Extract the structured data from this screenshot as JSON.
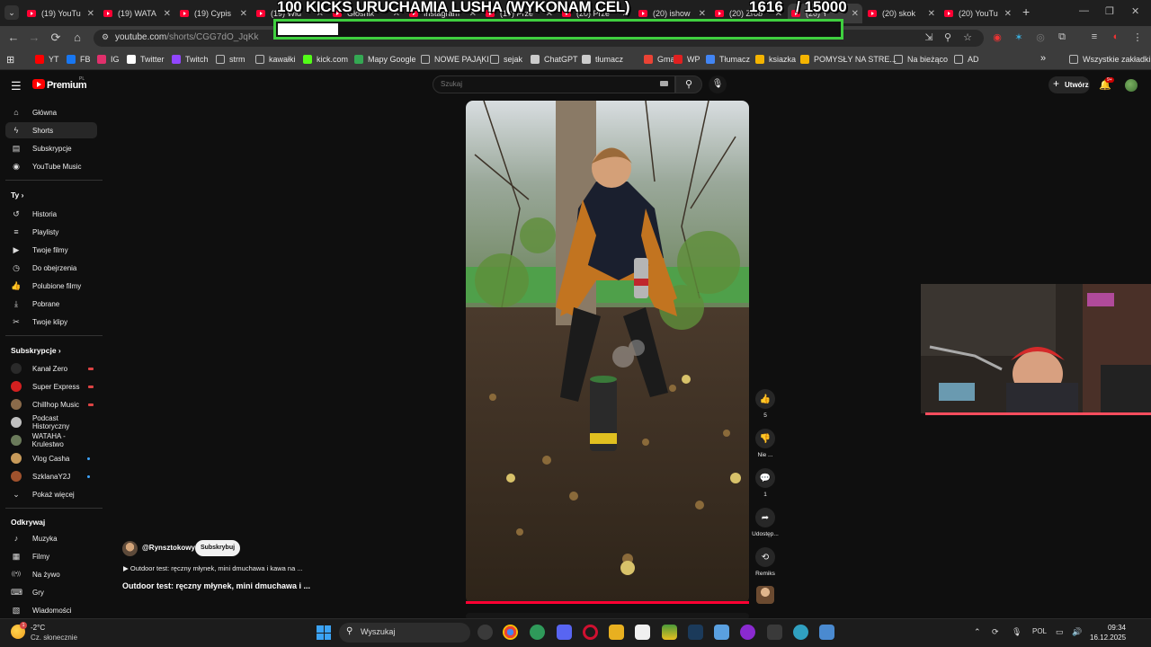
{
  "browser": {
    "tabs": [
      {
        "label": "(19) YouTu",
        "active": false
      },
      {
        "label": "(19) WATA",
        "active": false
      },
      {
        "label": "(19) Cypis",
        "active": false
      },
      {
        "label": "(19) Wid",
        "active": false
      },
      {
        "label": "Głośnik",
        "active": false
      },
      {
        "label": "Instagram",
        "active": false
      },
      {
        "label": "(19) Prze",
        "active": false
      },
      {
        "label": "(20) Prze",
        "active": false
      },
      {
        "label": "(20) ishow",
        "active": false
      },
      {
        "label": "(20) Zrób",
        "active": false
      },
      {
        "label": "(20) Y",
        "active": true
      },
      {
        "label": "(20) skok",
        "active": false
      },
      {
        "label": "(20) YouTu",
        "active": false
      }
    ],
    "url_host": "youtube.com",
    "url_path": "/shorts/CGG7dO_JqKk",
    "bookmarks": [
      {
        "label": "YT",
        "icon": "youtube-icon",
        "color": "#ff0000"
      },
      {
        "label": "FB",
        "icon": "facebook-icon",
        "color": "#1877f2"
      },
      {
        "label": "IG",
        "icon": "instagram-icon",
        "color": "#e1306c"
      },
      {
        "label": "Twitter",
        "icon": "x-icon",
        "color": "#ffffff"
      },
      {
        "label": "Twitch",
        "icon": "twitch-icon",
        "color": "#9146ff"
      },
      {
        "label": "strm",
        "icon": "folder-icon",
        "color": ""
      },
      {
        "label": "kawałki",
        "icon": "folder-icon",
        "color": ""
      },
      {
        "label": "kick.com",
        "icon": "kick-icon",
        "color": "#53fc18"
      },
      {
        "label": "Mapy Google",
        "icon": "maps-icon",
        "color": "#34a853"
      },
      {
        "label": "NOWE PAJĄKI",
        "icon": "folder-icon",
        "color": ""
      },
      {
        "label": "sejak",
        "icon": "folder-icon",
        "color": ""
      },
      {
        "label": "ChatGPT",
        "icon": "chatgpt-icon",
        "color": "#cccccc"
      },
      {
        "label": "tłumacz",
        "icon": "translate-icon",
        "color": "#cccccc"
      },
      {
        "label": "Gmail",
        "icon": "gmail-icon",
        "color": "#ea4335"
      },
      {
        "label": "WP",
        "icon": "wp-icon",
        "color": "#e02020"
      },
      {
        "label": "Tłumacz",
        "icon": "translate-icon",
        "color": "#4285f4"
      },
      {
        "label": "ksiazka",
        "icon": "book-icon",
        "color": "#f4b400"
      },
      {
        "label": "POMYSŁY NA STRE...",
        "icon": "grid-icon",
        "color": "#f4b400"
      },
      {
        "label": "Na bieżąco",
        "icon": "folder-icon",
        "color": ""
      },
      {
        "label": "AD",
        "icon": "folder-icon",
        "color": ""
      }
    ],
    "all_bookmarks": "Wszystkie zakładki"
  },
  "overlay": {
    "title": "100 KICKS URUCHAMIA LUSHA (WYKONAM CEL)",
    "current": "1616",
    "goal": "/ 15000",
    "progress": 0.108
  },
  "youtube": {
    "premium": "Premium",
    "region": "PL",
    "search_placeholder": "Szukaj",
    "create_label": "Utwórz",
    "notifications": "9+",
    "nav_main": [
      {
        "label": "Główna",
        "icon": "home-icon"
      },
      {
        "label": "Shorts",
        "icon": "shorts-icon"
      },
      {
        "label": "Subskrypcje",
        "icon": "subscriptions-icon"
      },
      {
        "label": "YouTube Music",
        "icon": "music-icon"
      }
    ],
    "you_heading": "Ty",
    "nav_you": [
      {
        "label": "Historia",
        "icon": "history-icon"
      },
      {
        "label": "Playlisty",
        "icon": "playlist-icon"
      },
      {
        "label": "Twoje filmy",
        "icon": "video-icon"
      },
      {
        "label": "Do obejrzenia",
        "icon": "clock-icon"
      },
      {
        "label": "Polubione filmy",
        "icon": "like-icon"
      },
      {
        "label": "Pobrane",
        "icon": "download-icon"
      },
      {
        "label": "Twoje klipy",
        "icon": "scissors-icon"
      }
    ],
    "subs_heading": "Subskrypcje",
    "subscriptions": [
      {
        "label": "Kanał Zero",
        "avatar": "#2a2a2a",
        "status": "live"
      },
      {
        "label": "Super Express",
        "avatar": "#d32020",
        "status": "live"
      },
      {
        "label": "Chillhop Music",
        "avatar": "#8a6a4a",
        "status": "live"
      },
      {
        "label": "Podcast Historyczny",
        "avatar": "#bfbfbf",
        "status": ""
      },
      {
        "label": "WATAHA - Krulestwo",
        "avatar": "#6a7a5a",
        "status": ""
      },
      {
        "label": "Vlog Casha",
        "avatar": "#c79a5a",
        "status": "new"
      },
      {
        "label": "SzklanaY2J",
        "avatar": "#a0522d",
        "status": "new"
      }
    ],
    "show_more": "Pokaż więcej",
    "explore_heading": "Odkrywaj",
    "nav_explore": [
      {
        "label": "Muzyka",
        "icon": "music-note-icon"
      },
      {
        "label": "Filmy",
        "icon": "film-icon"
      },
      {
        "label": "Na żywo",
        "icon": "live-icon"
      },
      {
        "label": "Gry",
        "icon": "gamepad-icon"
      },
      {
        "label": "Wiadomości",
        "icon": "news-icon"
      }
    ],
    "short": {
      "channel": "@Rynsztokowy",
      "subscribe": "Subskrybuj",
      "subtitle": "Outdoor test: ręczny młynek, mini dmuchawa i kawa na ...",
      "title": "Outdoor test: ręczny młynek, mini dmuchawa i ...",
      "likes": "5",
      "dislike_label": "Nie ...",
      "comments": "1",
      "share_label": "Udostęp...",
      "remix_label": "Remiks",
      "progress": 1.0
    }
  },
  "taskbar": {
    "weather_temp": "-2°C",
    "weather_desc": "Cz. słonecznie",
    "weather_badge": "1",
    "search_label": "Wyszukaj",
    "lang": "POL",
    "time": "09:34",
    "date": "16.12.2025"
  }
}
